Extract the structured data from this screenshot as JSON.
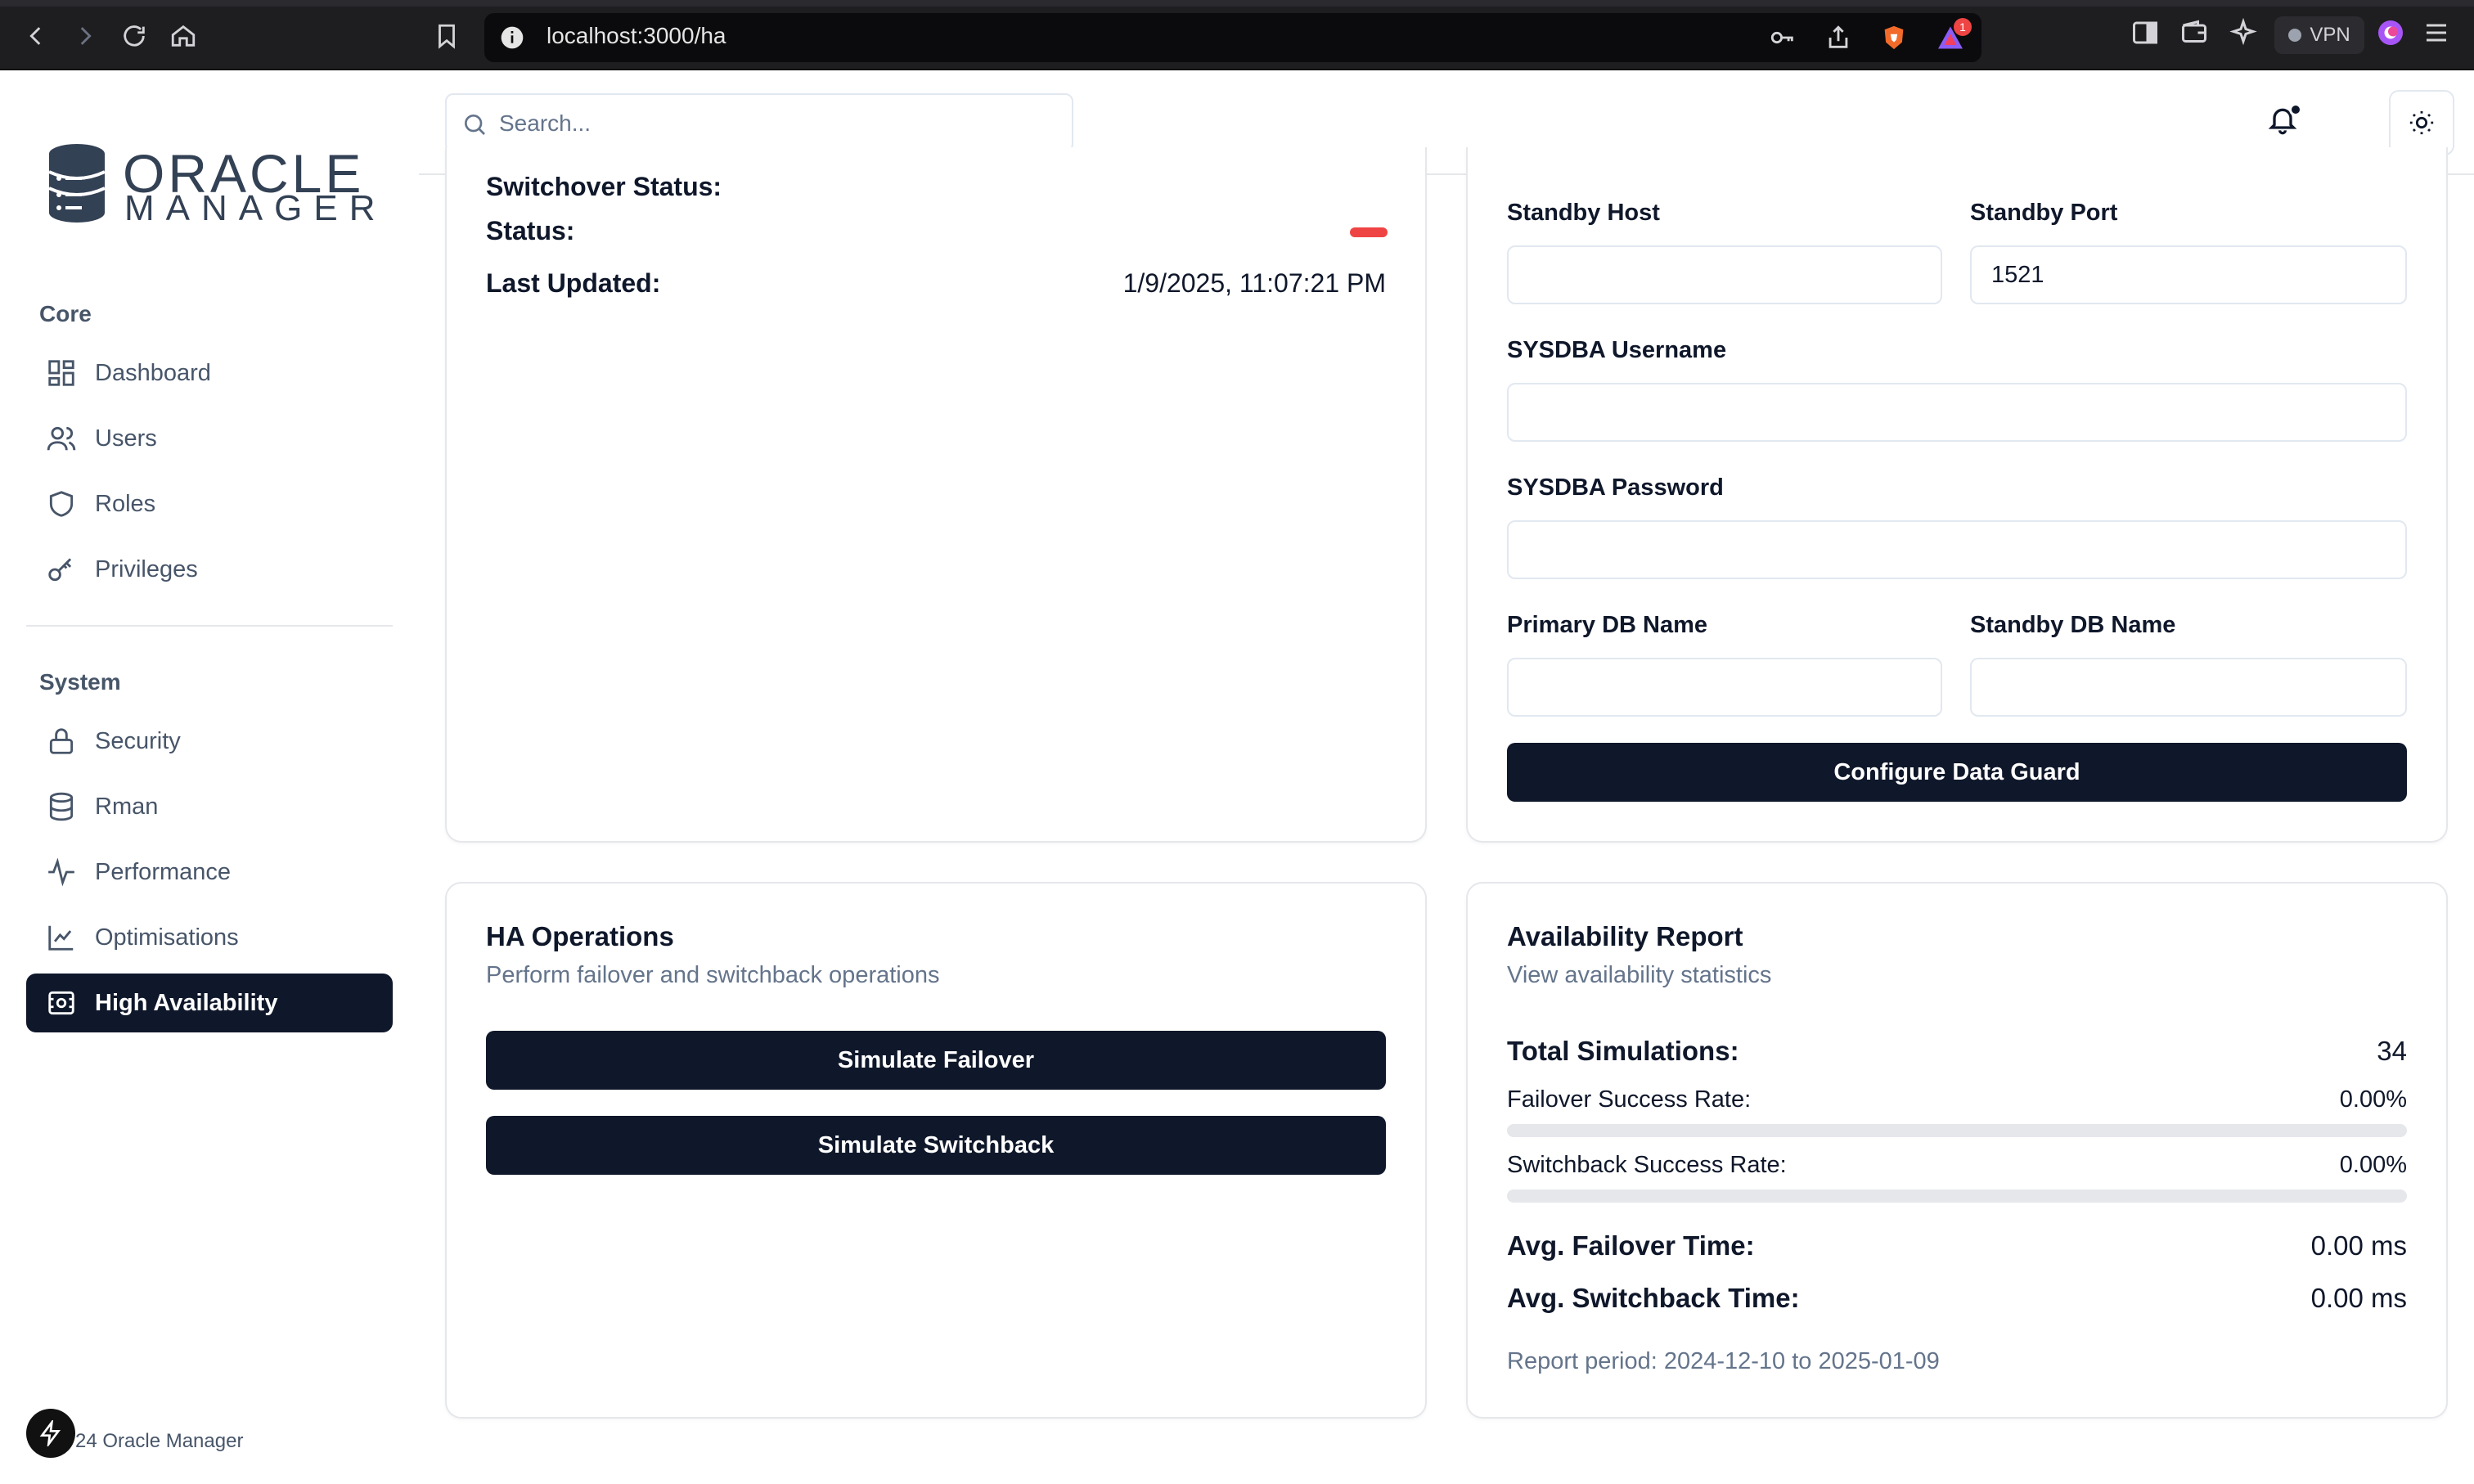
{
  "browser": {
    "url": "localhost:3000/ha",
    "vpn_label": "VPN",
    "notification_count": "1"
  },
  "app": {
    "logo_line1": "ORACLE",
    "logo_line2": "MANAGER",
    "footer": "24 Oracle Manager"
  },
  "sidebar": {
    "sections": [
      {
        "label": "Core",
        "items": [
          {
            "label": "Dashboard",
            "icon": "dashboard-icon"
          },
          {
            "label": "Users",
            "icon": "users-icon"
          },
          {
            "label": "Roles",
            "icon": "shield-icon"
          },
          {
            "label": "Privileges",
            "icon": "key-icon"
          }
        ]
      },
      {
        "label": "System",
        "items": [
          {
            "label": "Security",
            "icon": "lock-icon"
          },
          {
            "label": "Rman",
            "icon": "database-icon"
          },
          {
            "label": "Performance",
            "icon": "activity-icon"
          },
          {
            "label": "Optimisations",
            "icon": "line-chart-icon"
          },
          {
            "label": "High Availability",
            "icon": "server-icon",
            "active": true
          }
        ]
      }
    ]
  },
  "header": {
    "search_placeholder": "Search..."
  },
  "status_card": {
    "switchover_label": "Switchover Status:",
    "status_label": "Status:",
    "status_color": "#ef4444",
    "last_updated_label": "Last Updated:",
    "last_updated_value": "1/9/2025, 11:07:21 PM"
  },
  "config_card": {
    "standby_host_label": "Standby Host",
    "standby_host_value": "",
    "standby_port_label": "Standby Port",
    "standby_port_value": "1521",
    "sysdba_username_label": "SYSDBA Username",
    "sysdba_username_value": "",
    "sysdba_password_label": "SYSDBA Password",
    "sysdba_password_value": "",
    "primary_db_label": "Primary DB Name",
    "primary_db_value": "",
    "standby_db_label": "Standby DB Name",
    "standby_db_value": "",
    "configure_button": "Configure Data Guard"
  },
  "ha_ops": {
    "title": "HA Operations",
    "subtitle": "Perform failover and switchback operations",
    "failover_button": "Simulate Failover",
    "switchback_button": "Simulate Switchback"
  },
  "report": {
    "title": "Availability Report",
    "subtitle": "View availability statistics",
    "total_label": "Total Simulations:",
    "total_value": "34",
    "failover_rate_label": "Failover Success Rate:",
    "failover_rate_value": "0.00%",
    "failover_rate_fraction": 0.0,
    "switchback_rate_label": "Switchback Success Rate:",
    "switchback_rate_value": "0.00%",
    "switchback_rate_fraction": 0.0,
    "avg_failover_label": "Avg. Failover Time:",
    "avg_failover_value": "0.00 ms",
    "avg_switchback_label": "Avg. Switchback Time:",
    "avg_switchback_value": "0.00 ms",
    "period": "Report period: 2024-12-10 to 2025-01-09"
  }
}
